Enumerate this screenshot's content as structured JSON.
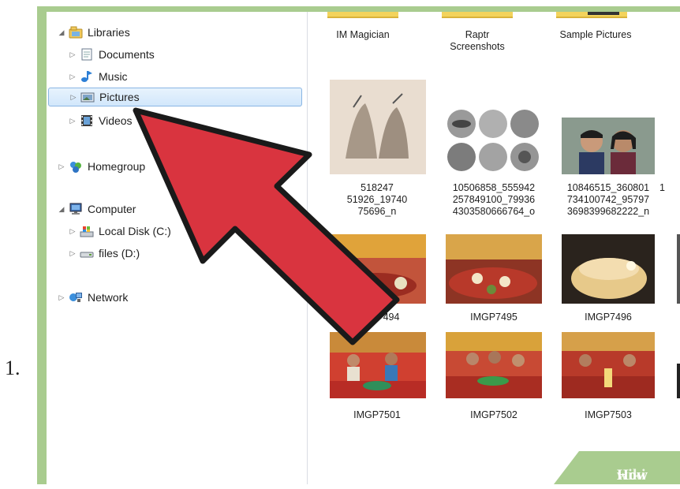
{
  "step_number": "1.",
  "sidebar": {
    "libraries": "Libraries",
    "documents": "Documents",
    "music": "Music",
    "pictures": "Pictures",
    "videos": "Videos",
    "homegroup": "Homegroup",
    "computer": "Computer",
    "local_disk": "Local Disk (C:)",
    "files": "files (D:)",
    "network": "Network"
  },
  "folders": [
    {
      "label": "IM Magician"
    },
    {
      "label": "Raptr\nScreenshots"
    },
    {
      "label": "Sample Pictures"
    }
  ],
  "files_row1": [
    {
      "label": "518247\n51926_19740\n75696_n"
    },
    {
      "label": "10506858_555942\n257849100_79936\n4303580666764_o"
    },
    {
      "label": "10846515_360801\n734100742_95797\n3698399682222_n"
    },
    {
      "label": "1"
    }
  ],
  "files_row2": [
    {
      "label": "494"
    },
    {
      "label": "IMGP7495"
    },
    {
      "label": "IMGP7496"
    }
  ],
  "files_row3": [
    {
      "label": "IMGP7501"
    },
    {
      "label": "IMGP7502"
    },
    {
      "label": "IMGP7503"
    }
  ],
  "watermark": {
    "wiki": "wiki",
    "how": "How"
  },
  "colors": {
    "frame": "#a9cc8f",
    "arrow_fill": "#d9343f",
    "arrow_stroke": "#1a1a1a",
    "selection": "#d2e7fb"
  }
}
